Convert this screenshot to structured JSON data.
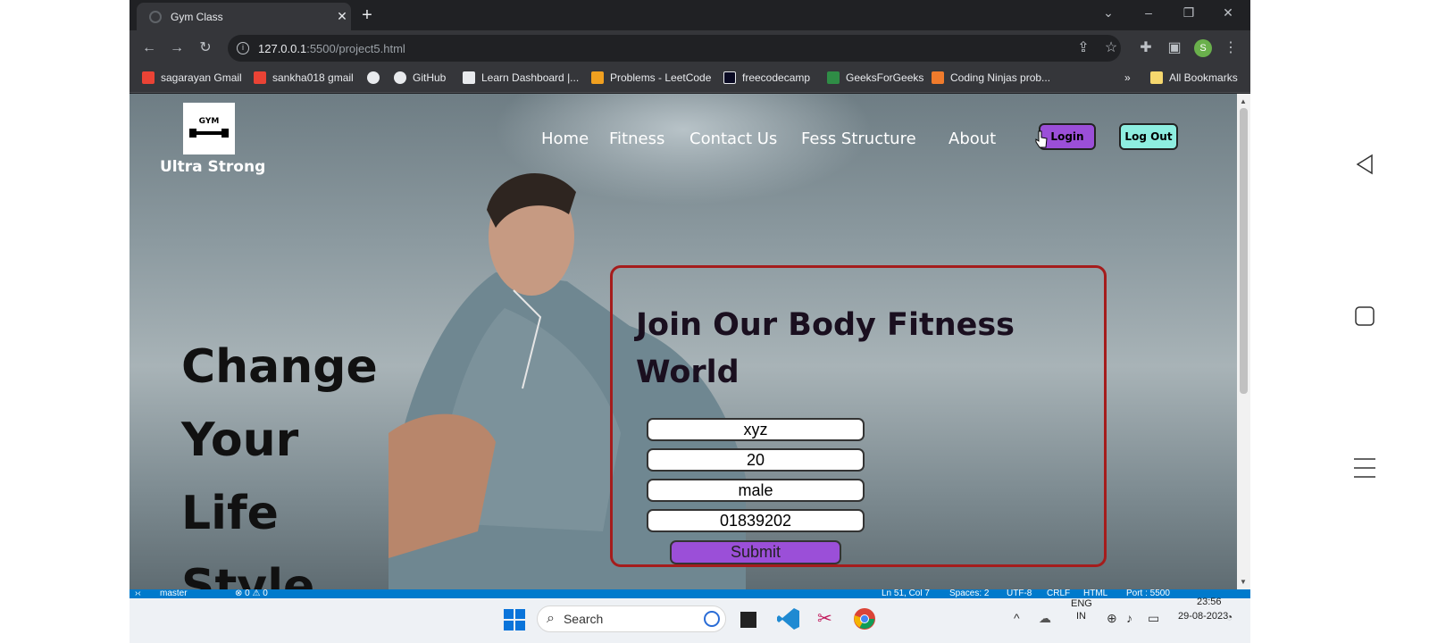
{
  "browser": {
    "tab_title": "Gym Class",
    "url_host": "127.0.0.1",
    "url_path": ":5500/project5.html",
    "profile_initial": "S",
    "bookmarks": [
      {
        "label": "sagarayan Gmail",
        "color": "#ea4335"
      },
      {
        "label": "sankha018 gmail",
        "color": "#ea4335"
      },
      {
        "label": "",
        "color": "#e8eaed"
      },
      {
        "label": "GitHub",
        "color": "#e8eaed"
      },
      {
        "label": "Learn Dashboard |...",
        "color": "#e8eaed"
      },
      {
        "label": "Problems - LeetCode",
        "color": "#f0a020"
      },
      {
        "label": "freecodecamp",
        "color": "#0a0a23"
      },
      {
        "label": "GeeksForGeeks",
        "color": "#2f8d46"
      },
      {
        "label": "Coding Ninjas prob...",
        "color": "#f07b2c"
      }
    ],
    "bookmarks_overflow": "»",
    "all_bookmarks": "All Bookmarks"
  },
  "site": {
    "logo_text": "GYM",
    "brand": "Ultra Strong",
    "nav": [
      "Home",
      "Fitness",
      "Contact Us",
      "Fess Structure",
      "About"
    ],
    "login": "Login",
    "logout": "Log Out",
    "hero_lines": [
      "Change",
      "Your",
      "Life",
      "Style"
    ],
    "form": {
      "heading": "Join Our Body Fitness World",
      "fields": [
        "xyz",
        "20",
        "male",
        "01839202"
      ],
      "submit": "Submit"
    }
  },
  "statusbar": {
    "branch": "master",
    "problems": "⊗ 0 ⚠ 0",
    "position": "Ln 51, Col 7",
    "spaces": "Spaces: 2",
    "encoding": "UTF-8",
    "eol": "CRLF",
    "language": "HTML",
    "port": "Port : 5500"
  },
  "taskbar": {
    "search": "Search",
    "lang_top": "ENG",
    "lang_bottom": "IN",
    "time": "23:56",
    "date": "29-08-2023"
  },
  "colors": {
    "accent_purple": "#9b4fd8",
    "accent_teal": "#8eeee0",
    "panel_border": "#a51c1c"
  }
}
